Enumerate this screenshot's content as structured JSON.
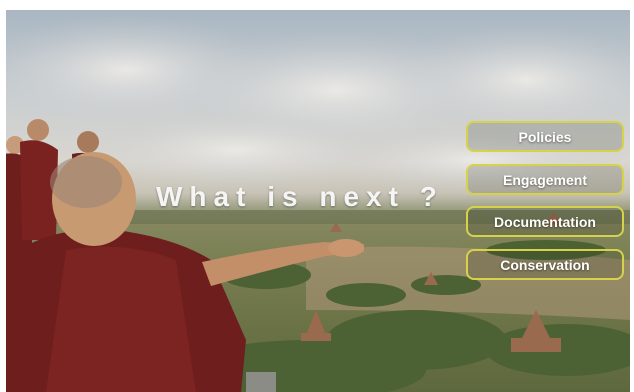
{
  "slide": {
    "title": "What is next ?",
    "options": [
      {
        "label": "Policies"
      },
      {
        "label": "Engagement"
      },
      {
        "label": "Documentation"
      },
      {
        "label": "Conservation"
      }
    ]
  },
  "colors": {
    "button_border": "#d6d24a",
    "title_text": "#f5f5f5",
    "robe": "#6e1e1c"
  }
}
